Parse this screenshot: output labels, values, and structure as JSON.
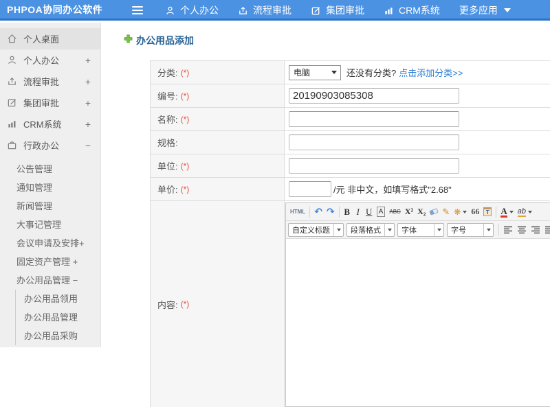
{
  "topbar": {
    "brand": "PHPOA协同办公软件",
    "menu": [
      {
        "label": "个人办公"
      },
      {
        "label": "流程审批"
      },
      {
        "label": "集团审批"
      },
      {
        "label": "CRM系统"
      },
      {
        "label": "更多应用"
      }
    ]
  },
  "sidebar": {
    "items": [
      {
        "label": "个人桌面",
        "expander": ""
      },
      {
        "label": "个人办公",
        "expander": "+"
      },
      {
        "label": "流程审批",
        "expander": "+"
      },
      {
        "label": "集团审批",
        "expander": "+"
      },
      {
        "label": "CRM系统",
        "expander": "+"
      },
      {
        "label": "行政办公",
        "expander": "−"
      }
    ],
    "submenu": [
      {
        "label": "公告管理"
      },
      {
        "label": "通知管理"
      },
      {
        "label": "新闻管理"
      },
      {
        "label": "大事记管理"
      },
      {
        "label": "会议申请及安排+"
      },
      {
        "label": "固定资产管理 +"
      },
      {
        "label": "办公用品管理 −"
      }
    ],
    "subsubmenu": [
      {
        "label": "办公用品领用"
      },
      {
        "label": "办公用品管理"
      },
      {
        "label": "办公用品采购"
      }
    ]
  },
  "main": {
    "title": "办公用品添加",
    "form": {
      "category": {
        "label": "分类:",
        "required": "(*)",
        "selected": "电脑",
        "hint": "还没有分类?",
        "link": "点击添加分类>>"
      },
      "code": {
        "label": "编号:",
        "required": "(*)",
        "value": "20190903085308"
      },
      "name": {
        "label": "名称:",
        "required": "(*)",
        "value": ""
      },
      "spec": {
        "label": "规格:",
        "required": "",
        "value": ""
      },
      "unit": {
        "label": "单位:",
        "required": "(*)",
        "value": ""
      },
      "price": {
        "label": "单价:",
        "required": "(*)",
        "value": "",
        "suffix": "/元 非中文，如填写格式\"2.68\""
      },
      "content": {
        "label": "内容:",
        "required": "(*)"
      }
    },
    "editor": {
      "row1": [
        {
          "name": "source-code",
          "glyph": "HTML"
        },
        {
          "name": "undo",
          "glyph": "↶"
        },
        {
          "name": "redo",
          "glyph": "↷"
        },
        {
          "name": "bold",
          "glyph": "B"
        },
        {
          "name": "italic",
          "glyph": "I"
        },
        {
          "name": "underline",
          "glyph": "U"
        },
        {
          "name": "font-border",
          "glyph": "A"
        },
        {
          "name": "strikethrough",
          "glyph": "ABC"
        },
        {
          "name": "superscript",
          "glyph": "X²"
        },
        {
          "name": "subscript",
          "glyph": "X₂"
        },
        {
          "name": "format-brush",
          "glyph": "✎"
        },
        {
          "name": "auto-typeset",
          "glyph": "❋"
        },
        {
          "name": "blockquote",
          "glyph": "66"
        },
        {
          "name": "paste-text",
          "glyph": "T"
        },
        {
          "name": "font-color",
          "glyph": "A"
        },
        {
          "name": "highlight",
          "glyph": "ab"
        }
      ],
      "row2_selects": [
        {
          "label": "自定义标题"
        },
        {
          "label": "段落格式"
        },
        {
          "label": "字体"
        },
        {
          "label": "字号"
        }
      ]
    }
  },
  "colors": {
    "topbar": "#4b92e3",
    "topbar_border": "#2d71c8",
    "title": "#2a6496",
    "required": "#e74c3c",
    "link": "#2a7ed3",
    "accent_green": "#7ac143"
  }
}
